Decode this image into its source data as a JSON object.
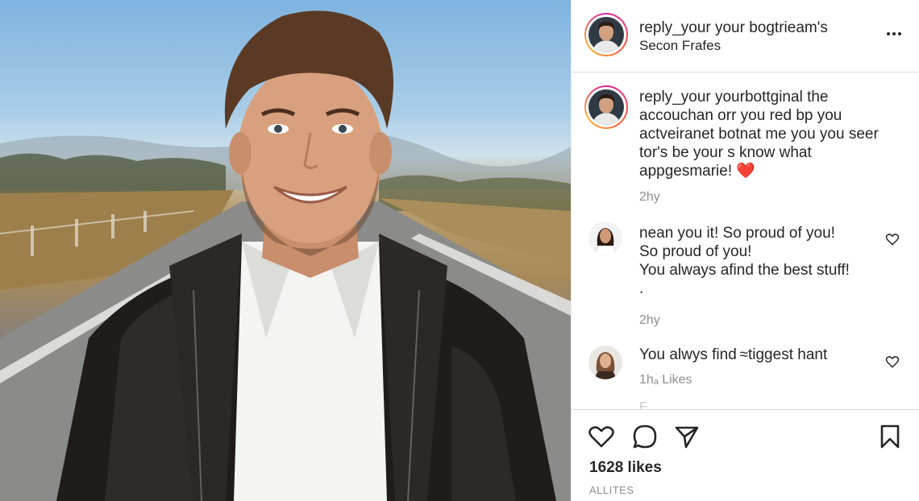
{
  "post": {
    "username": "reply_your your bogtrieam's",
    "subtitle": "Secon Frafes"
  },
  "caption": {
    "text": "reply_your yourbottginal the accouchan orr you red bp you actveiranet botnat me you you seer tor's be your s know what appgesmarie!",
    "emoji": "❤️",
    "time": "2hy"
  },
  "comments": [
    {
      "line1": "nean you it! So proud of you!",
      "line2": "So proud of you!",
      "line3": "You always afind the best stuff!",
      "line4": ".",
      "time": "2hy"
    },
    {
      "text": "You alwys find ≈tiggest hant",
      "meta": "1hₐ Likes"
    }
  ],
  "faded_text": "F . . . . . . .",
  "actions": {
    "likes": "1628 likes",
    "all": "ALLITES"
  },
  "icons": [
    "heart-icon",
    "comment-icon",
    "share-icon",
    "bookmark-icon",
    "more-icon"
  ],
  "colors": {
    "text": "#262626",
    "muted": "#8e8e8e",
    "heart": "#e0245e",
    "border": "#dbdbdb"
  }
}
